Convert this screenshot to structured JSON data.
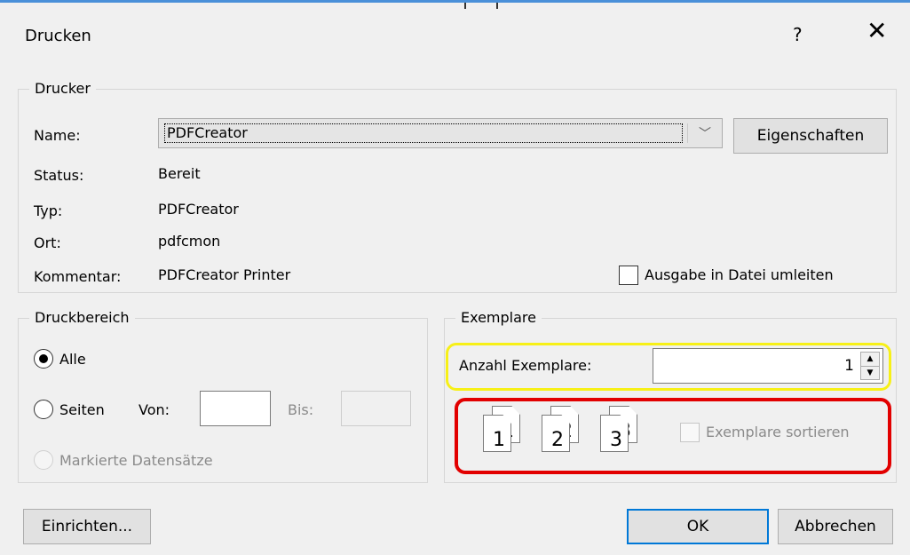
{
  "dialog": {
    "title": "Drucken",
    "help_glyph": "?",
    "close_glyph": "✕"
  },
  "printer": {
    "group_label": "Drucker",
    "name_label": "Name:",
    "name_value": "PDFCreator",
    "properties_button": "Eigenschaften",
    "status_label": "Status:",
    "status_value": "Bereit",
    "type_label": "Typ:",
    "type_value": "PDFCreator",
    "location_label": "Ort:",
    "location_value": "pdfcmon",
    "comment_label": "Kommentar:",
    "comment_value": "PDFCreator Printer",
    "redirect_label": "Ausgabe in Datei umleiten",
    "redirect_checked": false
  },
  "range": {
    "group_label": "Druckbereich",
    "all_label": "Alle",
    "all_selected": true,
    "pages_label": "Seiten",
    "from_label": "Von:",
    "from_value": "",
    "to_label": "Bis:",
    "to_value": "",
    "selected_records_label": "Markierte Datensätze"
  },
  "copies": {
    "group_label": "Exemplare",
    "count_label": "Anzahl Exemplare:",
    "count_value": "1",
    "collate_label": "Exemplare sortieren",
    "collate_checked": false,
    "collate_pages": [
      "1",
      "2",
      "3"
    ],
    "highlight_colors": {
      "count": "#f7f017",
      "collate": "#e20000"
    }
  },
  "buttons": {
    "setup": "Einrichten...",
    "ok": "OK",
    "cancel": "Abbrechen"
  },
  "icons": {
    "dropdown": "chevron-down-icon",
    "spin_up": "▲",
    "spin_down": "▼",
    "combo_arrow": "﹀"
  }
}
